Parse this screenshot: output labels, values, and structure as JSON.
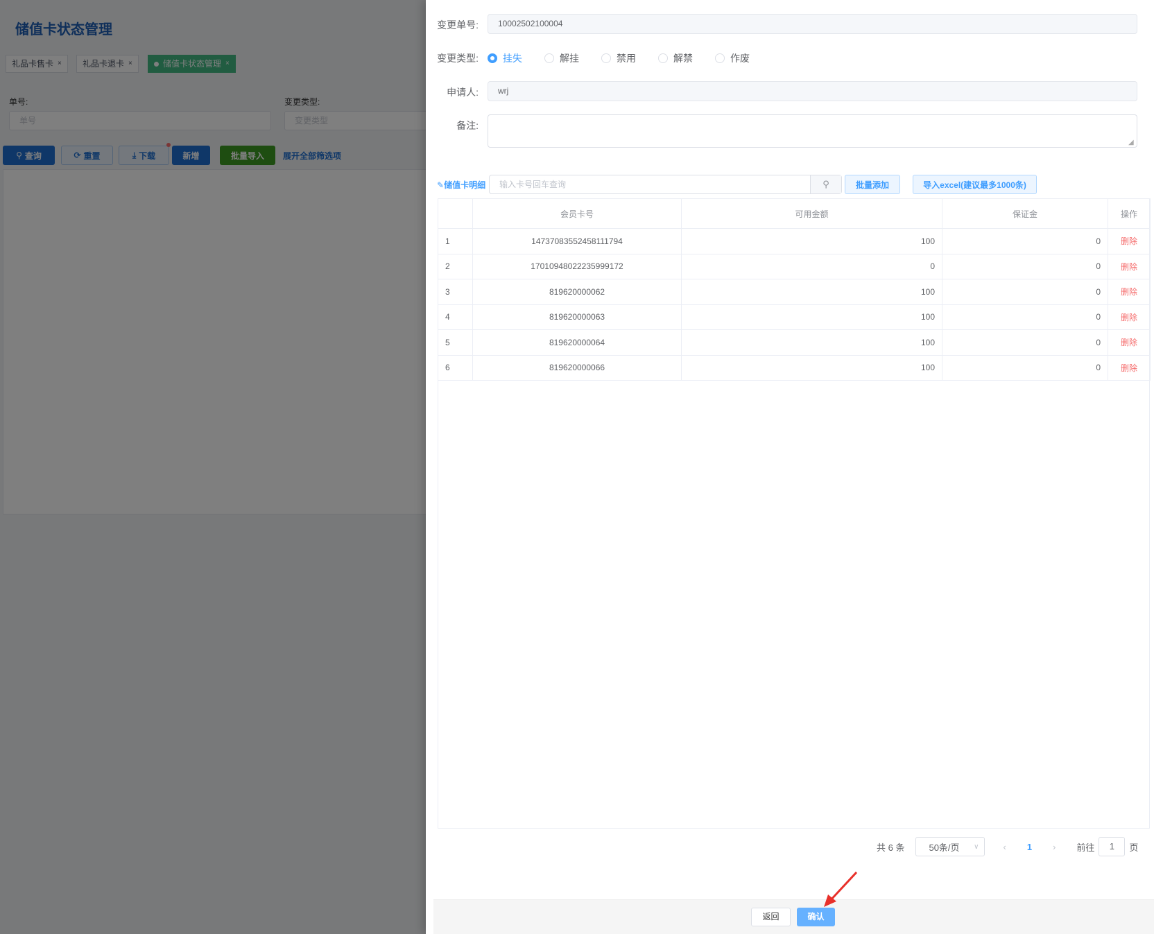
{
  "background_page": {
    "title": "储值卡状态管理",
    "tabs": [
      {
        "label": "礼品卡售卡",
        "active": false
      },
      {
        "label": "礼品卡退卡",
        "active": false
      },
      {
        "label": "储值卡状态管理",
        "active": true
      }
    ],
    "tab_close": "×",
    "filters": {
      "order_label": "单号:",
      "order_placeholder": "单号",
      "type_label": "变更类型:",
      "type_placeholder": "变更类型"
    },
    "buttons": {
      "query": "查询",
      "reset": "重置",
      "download": "下载",
      "add": "新增",
      "batch_import": "批量导入",
      "expand": "展开全部筛选项"
    }
  },
  "form": {
    "change_no_label": "变更单号:",
    "change_no": "10002502100004",
    "change_type_label": "变更类型:",
    "change_types": [
      {
        "label": "挂失",
        "checked": true
      },
      {
        "label": "解挂",
        "checked": false
      },
      {
        "label": "禁用",
        "checked": false
      },
      {
        "label": "解禁",
        "checked": false
      },
      {
        "label": "作废",
        "checked": false
      }
    ],
    "applicant_label": "申请人:",
    "applicant": "wrj",
    "remark_label": "备注:",
    "remark": ""
  },
  "detail": {
    "label": "储值卡明细",
    "search_placeholder": "输入卡号回车查询",
    "batch_add": "批量添加",
    "import_excel": "导入excel(建议最多1000条)",
    "columns": [
      "",
      "会员卡号",
      "可用金额",
      "保证金",
      "操作"
    ],
    "rows": [
      {
        "idx": "1",
        "card": "14737083552458111794",
        "amount": "100",
        "deposit": "0",
        "op": "删除"
      },
      {
        "idx": "2",
        "card": "17010948022235999172",
        "amount": "0",
        "deposit": "0",
        "op": "删除"
      },
      {
        "idx": "3",
        "card": "819620000062",
        "amount": "100",
        "deposit": "0",
        "op": "删除"
      },
      {
        "idx": "4",
        "card": "819620000063",
        "amount": "100",
        "deposit": "0",
        "op": "删除"
      },
      {
        "idx": "5",
        "card": "819620000064",
        "amount": "100",
        "deposit": "0",
        "op": "删除"
      },
      {
        "idx": "6",
        "card": "819620000066",
        "amount": "100",
        "deposit": "0",
        "op": "删除"
      }
    ]
  },
  "pagination": {
    "total": "共 6 条",
    "page_size": "50条/页",
    "current": "1",
    "goto_label": "前往",
    "goto_value": "1",
    "page_suffix": "页"
  },
  "footer": {
    "back": "返回",
    "confirm": "确认"
  },
  "colors": {
    "primary": "#409eff",
    "danger": "#f56c6c",
    "tag_active": "#42b983",
    "arrow": "#e8302a"
  }
}
